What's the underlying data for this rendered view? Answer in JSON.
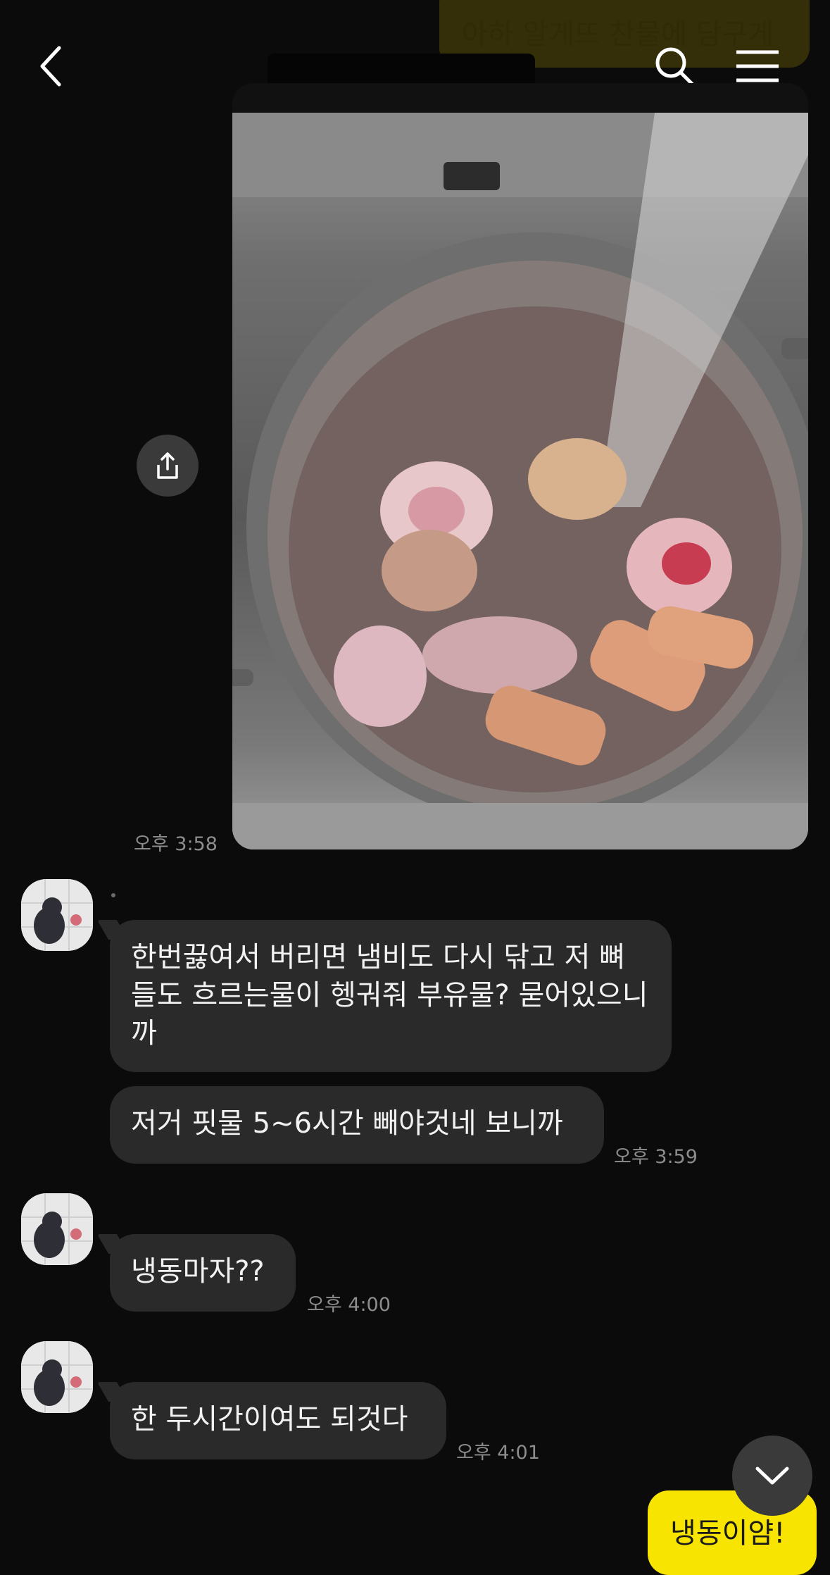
{
  "header": {
    "back_icon": "chevron-left-icon",
    "search_icon": "search-icon",
    "menu_icon": "hamburger-menu-icon"
  },
  "top_partial_message": {
    "text": "아하 알게뜨 찬물에 담구게"
  },
  "photo_message": {
    "time": "오후 3:58",
    "share_icon": "share-upload-icon",
    "alt": "pot"
  },
  "messages": [
    {
      "text": "한번끓여서 버리면 냄비도 다시 닦고 저 뼈들도 흐르는물이 헹궈줘 부유물? 묻어있으니까",
      "time": ""
    },
    {
      "text": "저거 핏물 5~6시간 빼야것네 보니까",
      "time": "오후 3:59"
    },
    {
      "text": "냉동마자??",
      "time": "오후 4:00"
    },
    {
      "text": "한 두시간이여도 되것다",
      "time": "오후 4:01"
    }
  ],
  "bottom_partial_message": {
    "text": "냉동이얌!"
  },
  "colors": {
    "background": "#0b0b0b",
    "bubble_other": "#2a2a2a",
    "bubble_me": "#f7e400",
    "time_text": "#8d8d8d"
  }
}
